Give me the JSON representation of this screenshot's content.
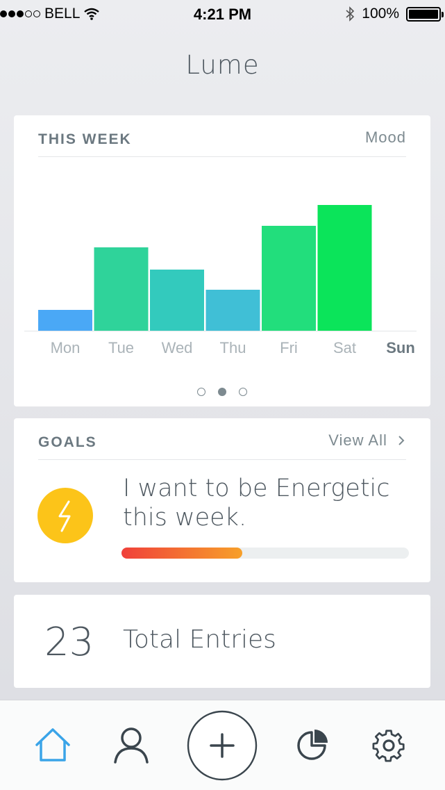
{
  "status_bar": {
    "carrier": "BELL",
    "time": "4:21 PM",
    "battery": "100%"
  },
  "app": {
    "title": "Lume"
  },
  "week_card": {
    "title": "THIS WEEK",
    "action": "Mood",
    "chart_data": {
      "type": "bar",
      "categories": [
        "Mon",
        "Tue",
        "Wed",
        "Thu",
        "Fri",
        "Sat",
        "Sun"
      ],
      "values": [
        30,
        120,
        88,
        59,
        151,
        181,
        0
      ],
      "colors": [
        "#4aa8f6",
        "#2fd39a",
        "#33cabd",
        "#40bfd6",
        "#22de7c",
        "#0be45a",
        "#ffffff"
      ],
      "active_category": "Sun",
      "pages": 3,
      "active_page": 2
    }
  },
  "goals_card": {
    "title": "GOALS",
    "action": "View All",
    "goal_text": "I want to be Energetic this week.",
    "progress": 0.42,
    "icon": "lightning-icon",
    "icon_color": "#fcc419"
  },
  "entries_card": {
    "count": "23",
    "label": "Total Entries"
  },
  "tab_bar": {
    "tabs": [
      "home-icon",
      "profile-icon",
      "add-icon",
      "stats-icon",
      "settings-icon"
    ],
    "active_tab": "home-icon",
    "active_color": "#3aa4e8",
    "inactive_color": "#3a454d"
  }
}
